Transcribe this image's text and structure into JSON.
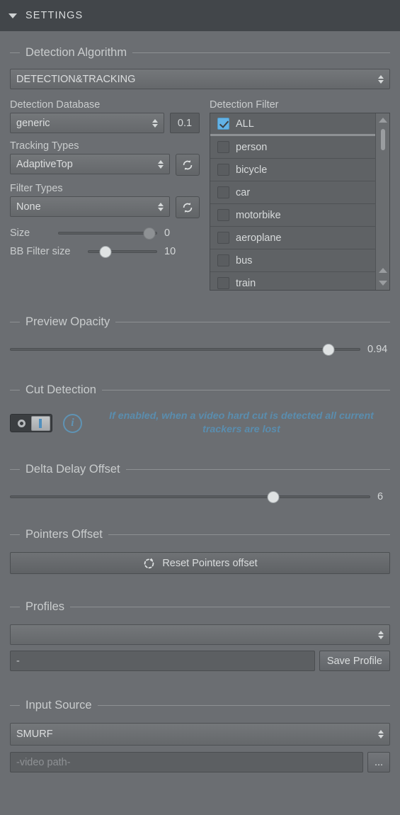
{
  "titlebar": {
    "collapse_icon": "triangle-down-icon",
    "title": "SETTINGS"
  },
  "detection_algorithm": {
    "section_title": "Detection Algorithm",
    "algorithm_value": "DETECTION&TRACKING",
    "database_label": "Detection Database",
    "database_value": "generic",
    "threshold_value": "0.1",
    "tracking_label": "Tracking Types",
    "tracking_value": "AdaptiveTop",
    "tracking_refresh_icon": "refresh-icon",
    "filter_types_label": "Filter Types",
    "filter_types_value": "None",
    "filter_refresh_icon": "refresh-icon",
    "size_label": "Size",
    "size_value": "0",
    "size_pct": 92,
    "bb_label": "BB Filter size",
    "bb_value": "10",
    "bb_pct": 26
  },
  "detection_filter": {
    "label": "Detection Filter",
    "items": [
      {
        "label": "ALL",
        "checked": true
      },
      {
        "label": "person",
        "checked": false
      },
      {
        "label": "bicycle",
        "checked": false
      },
      {
        "label": "car",
        "checked": false
      },
      {
        "label": "motorbike",
        "checked": false
      },
      {
        "label": "aeroplane",
        "checked": false
      },
      {
        "label": "bus",
        "checked": false
      },
      {
        "label": "train",
        "checked": false
      }
    ]
  },
  "preview_opacity": {
    "section_title": "Preview Opacity",
    "value": "0.94",
    "pct": 91
  },
  "cut_detection": {
    "section_title": "Cut Detection",
    "toggle_state": "on",
    "info_icon": "info-icon",
    "hint": "If enabled, when a video hard cut is detected all current trackers are lost",
    "hint_color": "#5a8dae"
  },
  "delta_delay_offset": {
    "section_title": "Delta Delay Offset",
    "value": "6",
    "pct": 73
  },
  "pointers_offset": {
    "section_title": "Pointers Offset",
    "reset_icon": "reset-circular-arrow-icon",
    "reset_label": "Reset Pointers offset"
  },
  "profiles": {
    "section_title": "Profiles",
    "profile_select_value": "",
    "profile_name_value": "-",
    "save_label": "Save Profile"
  },
  "input_source": {
    "section_title": "Input Source",
    "source_value": "SMURF",
    "path_placeholder": "-video path-",
    "browse_label": "..."
  },
  "colors": {
    "background": "#6b6e72",
    "titlebar": "#42464a",
    "accent_blue": "#62b2e6",
    "hint_blue": "#5a8dae"
  }
}
